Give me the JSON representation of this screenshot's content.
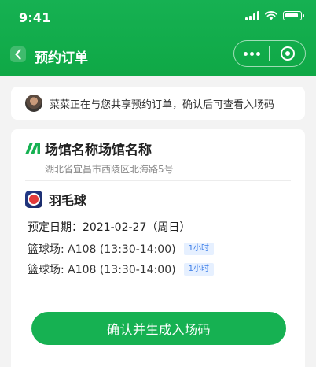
{
  "status_bar": {
    "time": "9:41"
  },
  "nav": {
    "title": "预约订单"
  },
  "share": {
    "text": "菜菜正在与您共享预约订单，确认后可查看入场码"
  },
  "venue": {
    "name": "场馆名称场馆名称",
    "address": "湖北省宜昌市西陵区北海路5号"
  },
  "booking": {
    "sport": "羽毛球",
    "date": "预定日期：2021-02-27（周日）",
    "courts": [
      {
        "text": "篮球场: A108 (13:30-14:00)",
        "duration": "1小时"
      },
      {
        "text": "篮球场: A108 (13:30-14:00)",
        "duration": "1小时"
      }
    ]
  },
  "actions": {
    "confirm_label": "确认并生成入场码"
  },
  "colors": {
    "brand": "#16b152",
    "badge_text": "#3b7de8",
    "badge_bg": "#e6f0ff"
  }
}
